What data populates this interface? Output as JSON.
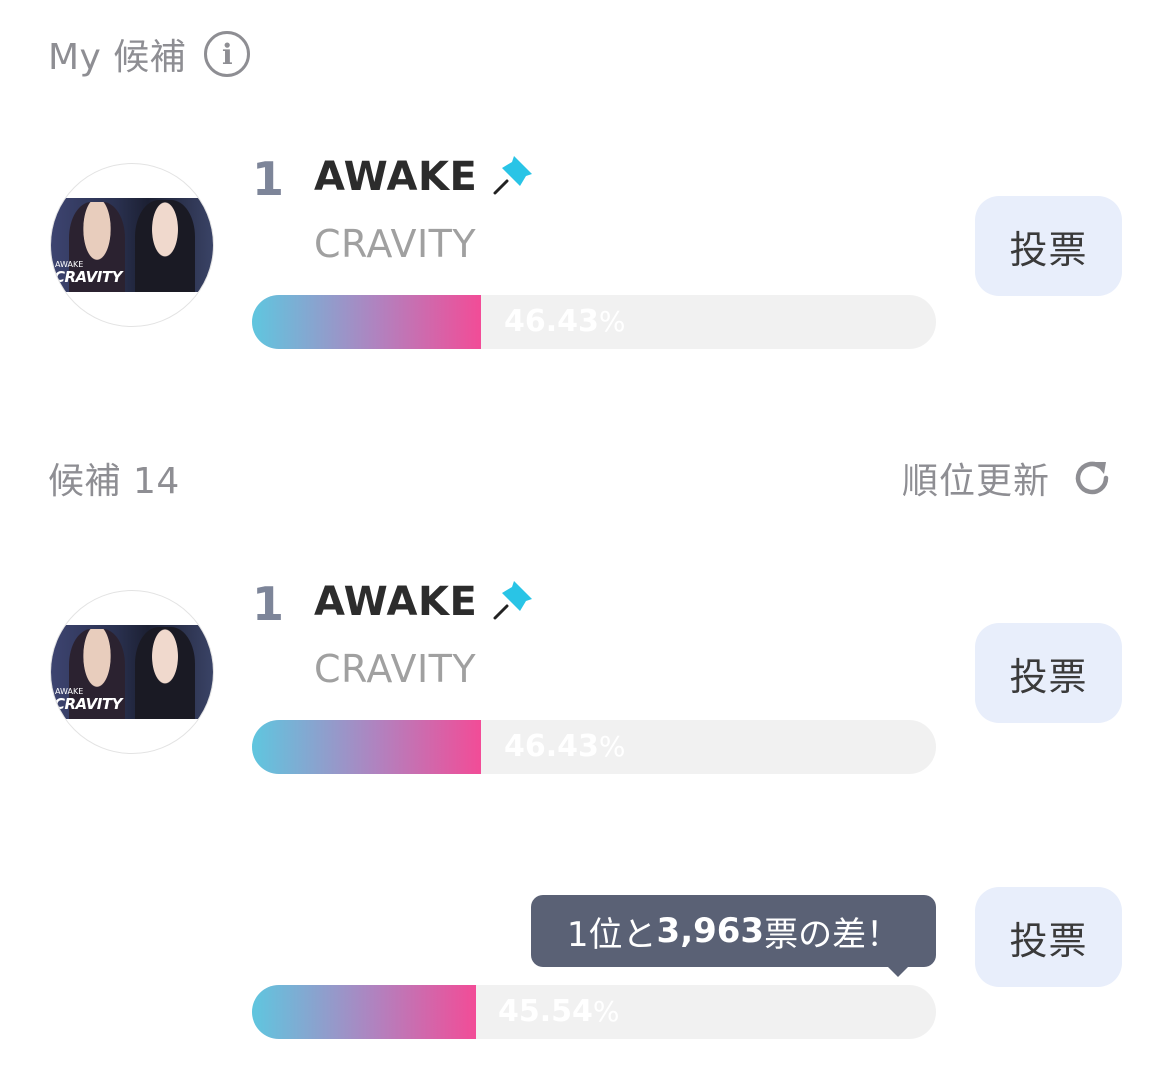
{
  "my_section": {
    "label": "My 候補",
    "info_icon": "info-icon"
  },
  "list_header": {
    "label": "候補 14",
    "refresh_label": "順位更新",
    "refresh_icon": "refresh-icon"
  },
  "my_candidate": {
    "rank": "1",
    "title": "AWAKE",
    "artist": "CRAVITY",
    "percent": "46.43",
    "percent_unit": "%",
    "percent_value": 46.43,
    "thumb_caption_small": "AWAKE",
    "thumb_caption": "CRAVITY",
    "vote_label": "投票",
    "pin_icon": "pin-icon"
  },
  "candidates": [
    {
      "rank": "1",
      "title": "AWAKE",
      "artist": "CRAVITY",
      "percent": "46.43",
      "percent_unit": "%",
      "percent_value": 46.43,
      "thumb_caption_small": "AWAKE",
      "thumb_caption": "CRAVITY",
      "vote_label": "投票",
      "pin_icon": "pin-icon"
    },
    {
      "percent": "45.54",
      "percent_unit": "%",
      "percent_value": 45.54,
      "vote_label": "投票",
      "tooltip_prefix": "1位と",
      "tooltip_votes": "3,963",
      "tooltip_suffix": "票の差！"
    }
  ],
  "colors": {
    "bar_start": "#5fc6df",
    "bar_end": "#f24c97",
    "pin": "#29c4e6",
    "vote_button_bg": "#e8eefb",
    "tooltip_bg": "#5a6175"
  }
}
